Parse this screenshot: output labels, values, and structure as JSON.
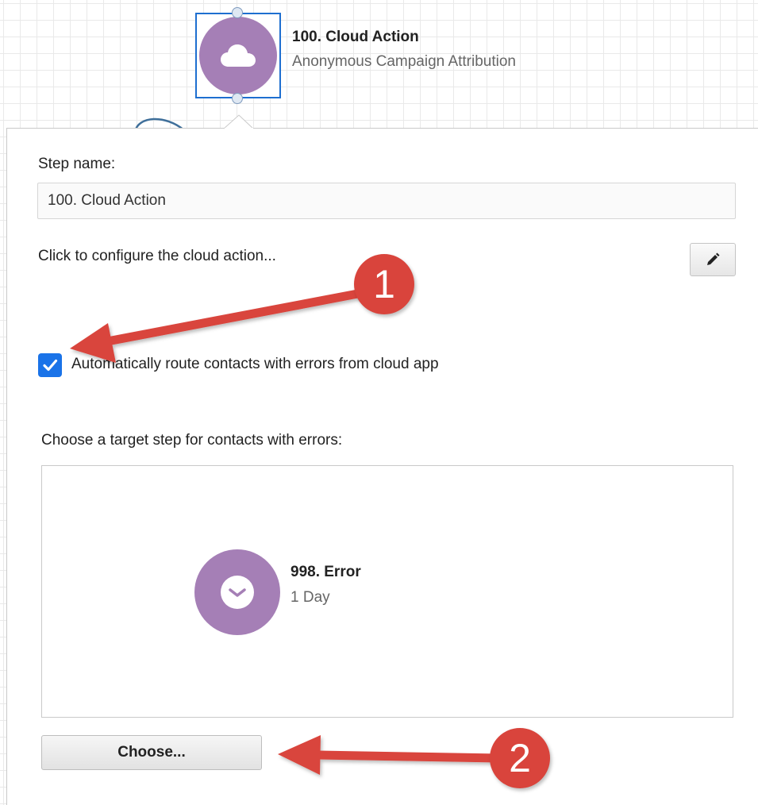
{
  "canvas": {
    "node": {
      "title": "100. Cloud Action",
      "subtitle": "Anonymous Campaign Attribution",
      "icon": "cloud-icon",
      "color": "#a57fb6",
      "selection_color": "#1e6fd0"
    }
  },
  "panel": {
    "step_name_label": "Step name:",
    "step_name_value": "100. Cloud Action",
    "configure_label": "Click to configure the cloud action...",
    "edit_icon": "pencil-icon",
    "auto_route": {
      "checked": true,
      "label": "Automatically route contacts with errors from cloud app"
    },
    "target_label": "Choose a target step for contacts with errors:",
    "target_step": {
      "title": "998. Error",
      "subtitle": "1 Day",
      "icon": "clock-icon"
    },
    "choose_button": "Choose..."
  },
  "annotations": {
    "callout_1": "1",
    "callout_2": "2",
    "color": "#d9443c"
  }
}
